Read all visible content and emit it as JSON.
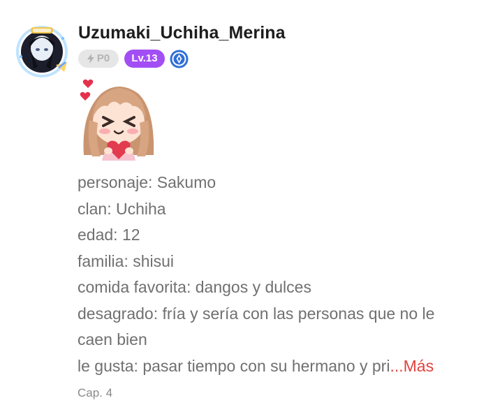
{
  "profile": {
    "username": "Uzumaki_Uchiha_Merina",
    "avatar_icon": "avatar-icon",
    "badges": {
      "points": "P0",
      "points_icon": "lightning-icon",
      "level": "Lv.13",
      "verified_icon": "diamond-badge-icon"
    }
  },
  "post": {
    "sticker_icon": "chibi-girl-heart-sticker",
    "bio_lines": [
      "personaje: Sakumo",
      "clan: Uchiha",
      "edad: 12",
      "familia: shisui",
      "comida favorita: dangos y dulces",
      "desagrado: fría y sería con las personas que no le",
      "caen bien",
      "le gusta: pasar tiempo con su hermano y pri"
    ],
    "ellipsis": "...",
    "more_label": "Más",
    "chapter": "Cap. 4"
  },
  "colors": {
    "level_badge": "#a24ef5",
    "more_link": "#e0433f",
    "verified_badge": "#2f6fd6"
  }
}
